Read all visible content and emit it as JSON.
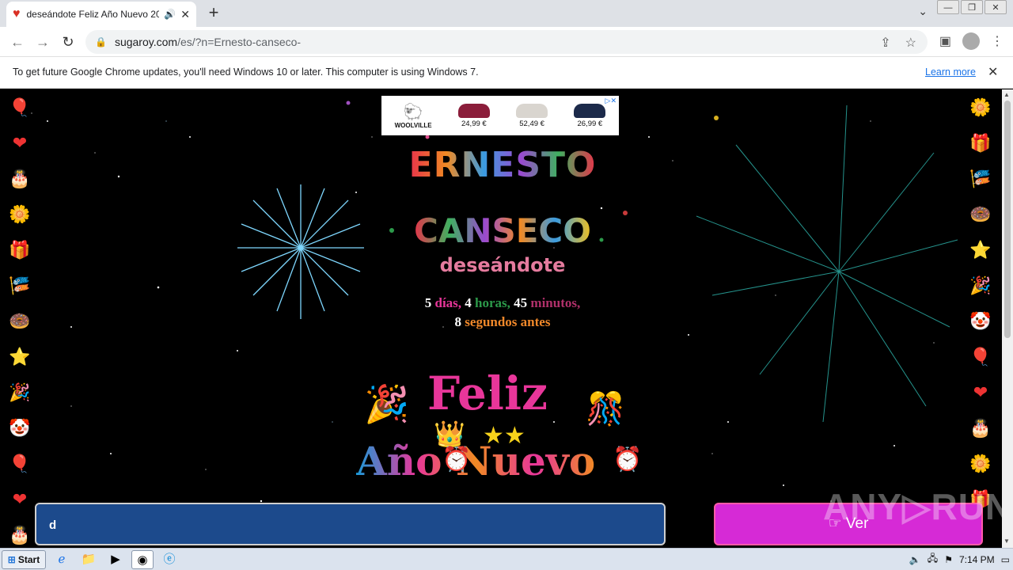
{
  "browser": {
    "tab_title": "deseándote Feliz Año Nuevo 20",
    "new_tab": "+",
    "url_host": "sugaroy.com",
    "url_path": "/es/?n=Ernesto-canseco-"
  },
  "infobar": {
    "message": "To get future Google Chrome updates, you'll need Windows 10 or later. This computer is using Windows 7.",
    "learn_more": "Learn more"
  },
  "ad": {
    "brand": "WOOLVILLE",
    "products": [
      {
        "price": "24,99 €"
      },
      {
        "price": "52,49 €"
      },
      {
        "price": "26,99 €"
      }
    ]
  },
  "greeting": {
    "first_name": "ERNESTO",
    "last_name": "CANSECO",
    "wishing": "deseándote",
    "countdown": {
      "days_num": "5",
      "days_label": "días,",
      "hours_num": "4",
      "hours_label": "horas,",
      "minutes_num": "45",
      "minutes_label": "minutos,",
      "seconds_num": "8",
      "seconds_label": "segundos antes"
    },
    "feliz": "Feliz",
    "ano_nuevo": "Año Nuevo"
  },
  "form": {
    "input_value": "d",
    "button_label": "☞ Ver"
  },
  "watermark": "ANY▷RUN",
  "left_icons": [
    "balloons-icon",
    "hearts-icon",
    "cake-icon",
    "flowers-icon",
    "gift-icon",
    "banner-icon",
    "donut-icon",
    "star-icon",
    "party-popper-icon",
    "clown-icon",
    "balloons-icon",
    "hearts-icon",
    "cake-icon"
  ],
  "left_glyphs": [
    "🎈",
    "❤",
    "🎂",
    "🌼",
    "🎁",
    "🎏",
    "🍩",
    "⭐",
    "🎉",
    "🤡",
    "🎈",
    "❤",
    "🎂"
  ],
  "right_icons": [
    "flowers-icon",
    "gift-icon",
    "banner-icon",
    "donut-icon",
    "star-icon",
    "party-popper-icon",
    "clown-icon",
    "balloons-icon",
    "hearts-icon",
    "cake-icon",
    "flowers-icon",
    "gift-icon"
  ],
  "right_glyphs": [
    "🌼",
    "🎁",
    "🎏",
    "🍩",
    "⭐",
    "🎉",
    "🤡",
    "🎈",
    "❤",
    "🎂",
    "🌼",
    "🎁"
  ],
  "taskbar": {
    "start": "Start",
    "time": "7:14 PM"
  }
}
